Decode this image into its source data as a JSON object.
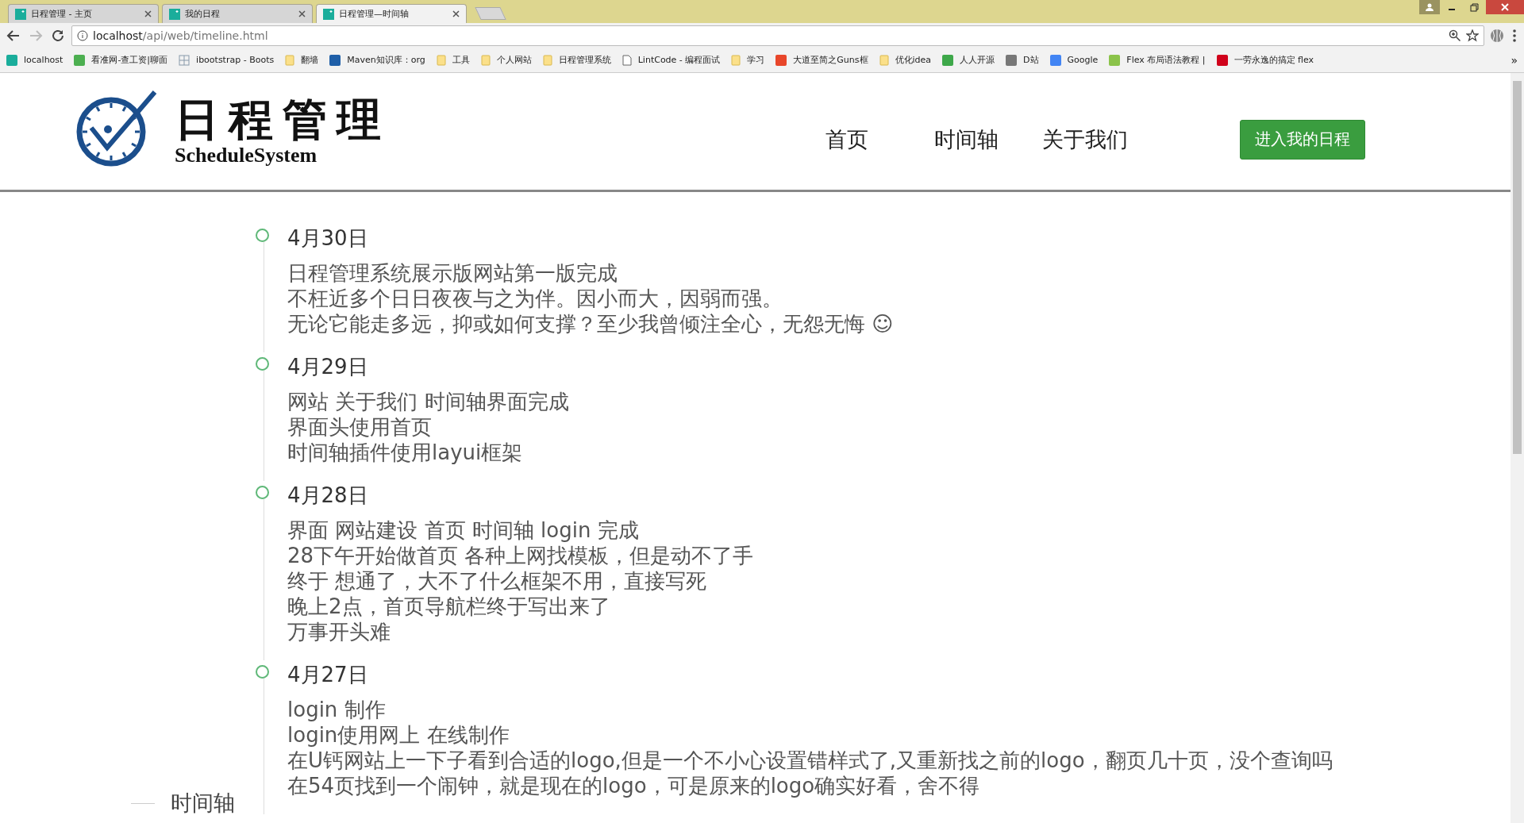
{
  "browser": {
    "tabs": [
      {
        "title": "日程管理 - 主页",
        "selected": false
      },
      {
        "title": "我的日程",
        "selected": false
      },
      {
        "title": "日程管理—时间轴",
        "selected": true
      }
    ],
    "address_host": "localhost",
    "address_path": "/api/web/timeline.html",
    "bookmarks": [
      {
        "kind": "site",
        "label": "localhost",
        "color": "#1aad9b"
      },
      {
        "kind": "site",
        "label": "看准网-查工资|聊面",
        "color": "#4caf50"
      },
      {
        "kind": "grid",
        "label": "ibootstrap - Boots"
      },
      {
        "kind": "folder",
        "label": "翻墙"
      },
      {
        "kind": "site",
        "label": "Maven知识库：org",
        "color": "#1f5fa8"
      },
      {
        "kind": "folder",
        "label": "工具"
      },
      {
        "kind": "folder",
        "label": "个人网站"
      },
      {
        "kind": "folder",
        "label": "日程管理系统"
      },
      {
        "kind": "page",
        "label": "LintCode - 编程面试"
      },
      {
        "kind": "folder",
        "label": "学习"
      },
      {
        "kind": "site",
        "label": "大道至简之Guns框",
        "color": "#e8462a"
      },
      {
        "kind": "folder",
        "label": "优化idea"
      },
      {
        "kind": "site",
        "label": "人人开源",
        "color": "#3ea84a"
      },
      {
        "kind": "site",
        "label": "D站",
        "color": "#777777"
      },
      {
        "kind": "site",
        "label": "Google",
        "color": "#4285f4"
      },
      {
        "kind": "site",
        "label": "Flex 布局语法教程 |",
        "color": "#8bc34a"
      },
      {
        "kind": "site",
        "label": "一劳永逸的搞定 flex",
        "color": "#d0021b"
      }
    ],
    "more": "»"
  },
  "header": {
    "logo_title": "日程管理",
    "logo_subtitle": "ScheduleSystem",
    "nav": [
      "首页",
      "时间轴",
      "关于我们"
    ],
    "cta": "进入我的日程"
  },
  "timeline": [
    {
      "date": "4月30日",
      "lines": [
        "日程管理系统展示版网站第一版完成",
        "不枉近多个日日夜夜与之为伴。因小而大，因弱而强。",
        "无论它能走多远，抑或如何支撑？至少我曾倾注全心，无怨无悔 ☺"
      ]
    },
    {
      "date": "4月29日",
      "lines": [
        "网站 关于我们 时间轴界面完成",
        "界面头使用首页",
        "时间轴插件使用layui框架"
      ]
    },
    {
      "date": "4月28日",
      "lines": [
        "界面 网站建设 首页 时间轴 login 完成",
        "28下午开始做首页 各种上网找模板，但是动不了手",
        "终于 想通了，大不了什么框架不用，直接写死",
        "晚上2点，首页导航栏终于写出来了",
        "万事开头难"
      ]
    },
    {
      "date": "4月27日",
      "lines": [
        "login 制作",
        "login使用网上 在线制作",
        "在U钙网站上一下子看到合适的logo,但是一个不小心设置错样式了,又重新找之前的logo，翻页几十页，没个查询吗",
        "在54页找到一个闹钟，就是现在的logo，可是原来的logo确实好看，舍不得"
      ]
    }
  ],
  "side_nav": "时间轴"
}
